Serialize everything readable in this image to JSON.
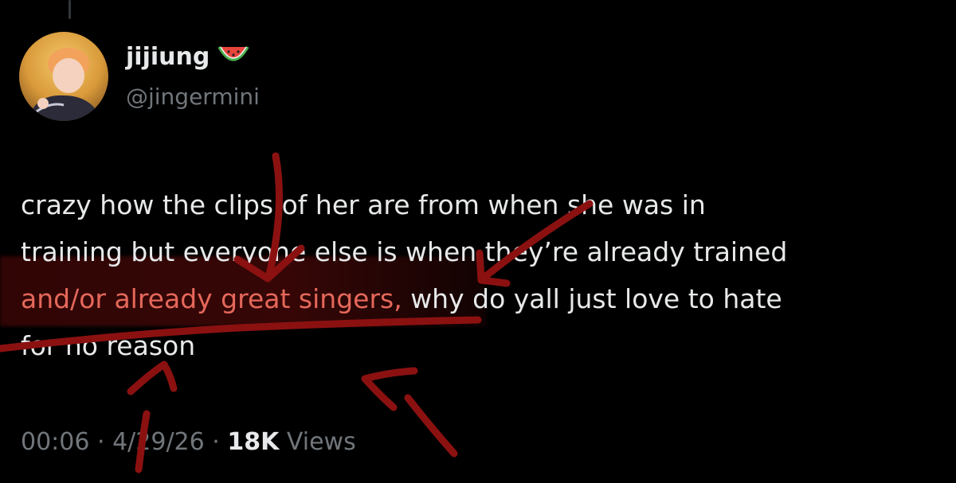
{
  "author": {
    "display_name": "jijiung",
    "handle": "@jingermini",
    "emoji": "watermelon"
  },
  "tweet": {
    "line1": "crazy how the clips of her are from when she was in",
    "line2": "training but everyone else is when they’re already trained",
    "highlighted": "and/or already great singers,",
    "line3_rest": " why do yall just love to hate",
    "line4": "for no reason"
  },
  "meta": {
    "time": "00:06",
    "sep1": " · ",
    "date": "4/29/26",
    "sep2": " · ",
    "views_count": "18K",
    "views_label": " Views"
  },
  "colors": {
    "background": "#000000",
    "text": "#e7e9ea",
    "muted": "#71767b",
    "annotation_red": "#8b1111",
    "highlight_text": "#e5685a"
  }
}
